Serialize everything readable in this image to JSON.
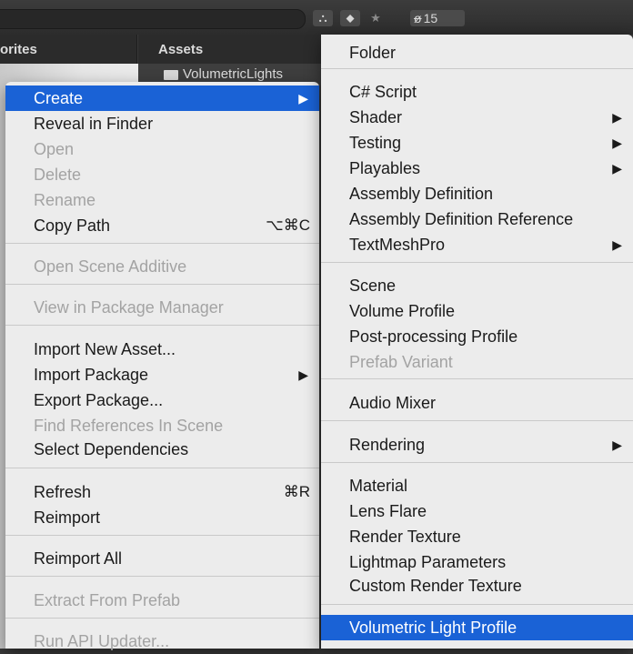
{
  "toolbar": {
    "hidden_count": "15"
  },
  "panes": {
    "favorites_header": "orites",
    "assets_header": "Assets",
    "folder_name": "VolumetricLights"
  },
  "context_menu": {
    "items": [
      {
        "label": "Create",
        "state": "selected",
        "submenu": true
      },
      {
        "label": "Reveal in Finder",
        "state": "enabled"
      },
      {
        "label": "Open",
        "state": "disabled"
      },
      {
        "label": "Delete",
        "state": "disabled"
      },
      {
        "label": "Rename",
        "state": "disabled"
      },
      {
        "label": "Copy Path",
        "state": "enabled",
        "shortcut": "⌥⌘C"
      },
      {
        "label": "Open Scene Additive",
        "state": "disabled"
      },
      {
        "label": "View in Package Manager",
        "state": "disabled"
      },
      {
        "label": "Import New Asset...",
        "state": "enabled"
      },
      {
        "label": "Import Package",
        "state": "enabled",
        "submenu": true
      },
      {
        "label": "Export Package...",
        "state": "enabled"
      },
      {
        "label": "Find References In Scene",
        "state": "disabled"
      },
      {
        "label": "Select Dependencies",
        "state": "enabled"
      },
      {
        "label": "Refresh",
        "state": "enabled",
        "shortcut": "⌘R"
      },
      {
        "label": "Reimport",
        "state": "enabled"
      },
      {
        "label": "Reimport All",
        "state": "enabled"
      },
      {
        "label": "Extract From Prefab",
        "state": "disabled"
      },
      {
        "label": "Run API Updater...",
        "state": "disabled"
      }
    ]
  },
  "create_submenu": {
    "items": [
      {
        "label": "Folder",
        "state": "enabled"
      },
      {
        "label": "C# Script",
        "state": "enabled"
      },
      {
        "label": "Shader",
        "state": "enabled",
        "submenu": true
      },
      {
        "label": "Testing",
        "state": "enabled",
        "submenu": true
      },
      {
        "label": "Playables",
        "state": "enabled",
        "submenu": true
      },
      {
        "label": "Assembly Definition",
        "state": "enabled"
      },
      {
        "label": "Assembly Definition Reference",
        "state": "enabled"
      },
      {
        "label": "TextMeshPro",
        "state": "enabled",
        "submenu": true
      },
      {
        "label": "Scene",
        "state": "enabled"
      },
      {
        "label": "Volume Profile",
        "state": "enabled"
      },
      {
        "label": "Post-processing Profile",
        "state": "enabled"
      },
      {
        "label": "Prefab Variant",
        "state": "disabled"
      },
      {
        "label": "Audio Mixer",
        "state": "enabled"
      },
      {
        "label": "Rendering",
        "state": "enabled",
        "submenu": true
      },
      {
        "label": "Material",
        "state": "enabled"
      },
      {
        "label": "Lens Flare",
        "state": "enabled"
      },
      {
        "label": "Render Texture",
        "state": "enabled"
      },
      {
        "label": "Lightmap Parameters",
        "state": "enabled"
      },
      {
        "label": "Custom Render Texture",
        "state": "enabled"
      },
      {
        "label": "Volumetric Light Profile",
        "state": "selected"
      }
    ]
  },
  "glyphs": {
    "submenu_arrow": "▶",
    "scene_icon": "⛬",
    "label_icon": "⬥",
    "star_icon": "★",
    "hidden_icon": "ø"
  },
  "colors": {
    "menu_bg": "#ececec",
    "selected_bg": "#1a62d6",
    "disabled_text": "#a3a3a3",
    "editor_dark": "#2b2b2b"
  }
}
